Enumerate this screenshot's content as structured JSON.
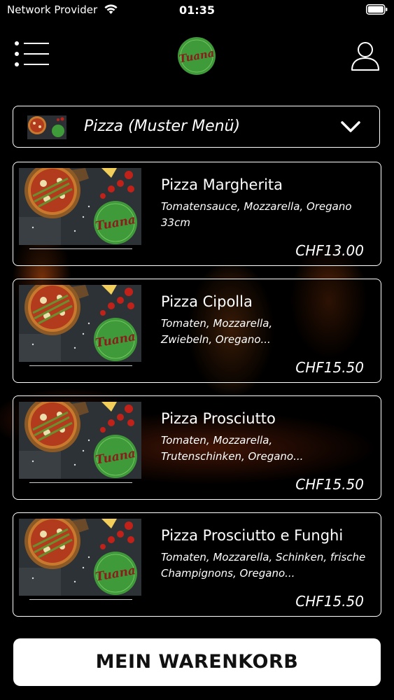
{
  "status_bar": {
    "carrier": "Network Provider",
    "time": "01:35",
    "wifi_icon": "wifi-icon",
    "battery_icon": "battery-icon"
  },
  "header": {
    "menu_icon": "menu-list-icon",
    "logo_text": "Tuana",
    "user_icon": "user-icon"
  },
  "category": {
    "label": "Pizza (Muster Menü)",
    "icon": "chevron-down-icon"
  },
  "products": [
    {
      "name": "Pizza Margherita",
      "desc_line1": "Tomatensauce, Mozzarella, Oregano",
      "desc_line2": "33cm",
      "price": "CHF13.00"
    },
    {
      "name": "Pizza Cipolla",
      "desc_line1": "Tomaten, Mozzarella,",
      "desc_line2": "Zwiebeln, Oregano...",
      "price": "CHF15.50"
    },
    {
      "name": "Pizza Prosciutto",
      "desc_line1": "Tomaten, Mozzarella,",
      "desc_line2": "Trutenschinken, Oregano...",
      "price": "CHF15.50"
    },
    {
      "name": "Pizza Prosciutto e Funghi",
      "desc_line1": "Tomaten, Mozzarella, Schinken, frische",
      "desc_line2": "Champignons, Oregano...",
      "price": "CHF15.50"
    }
  ],
  "cart_button": {
    "label": "MEIN WARENKORB"
  },
  "colors": {
    "background": "#000000",
    "logo_green": "#3f9a3a",
    "logo_text": "#8a1c1c",
    "button_bg": "#ffffff"
  }
}
